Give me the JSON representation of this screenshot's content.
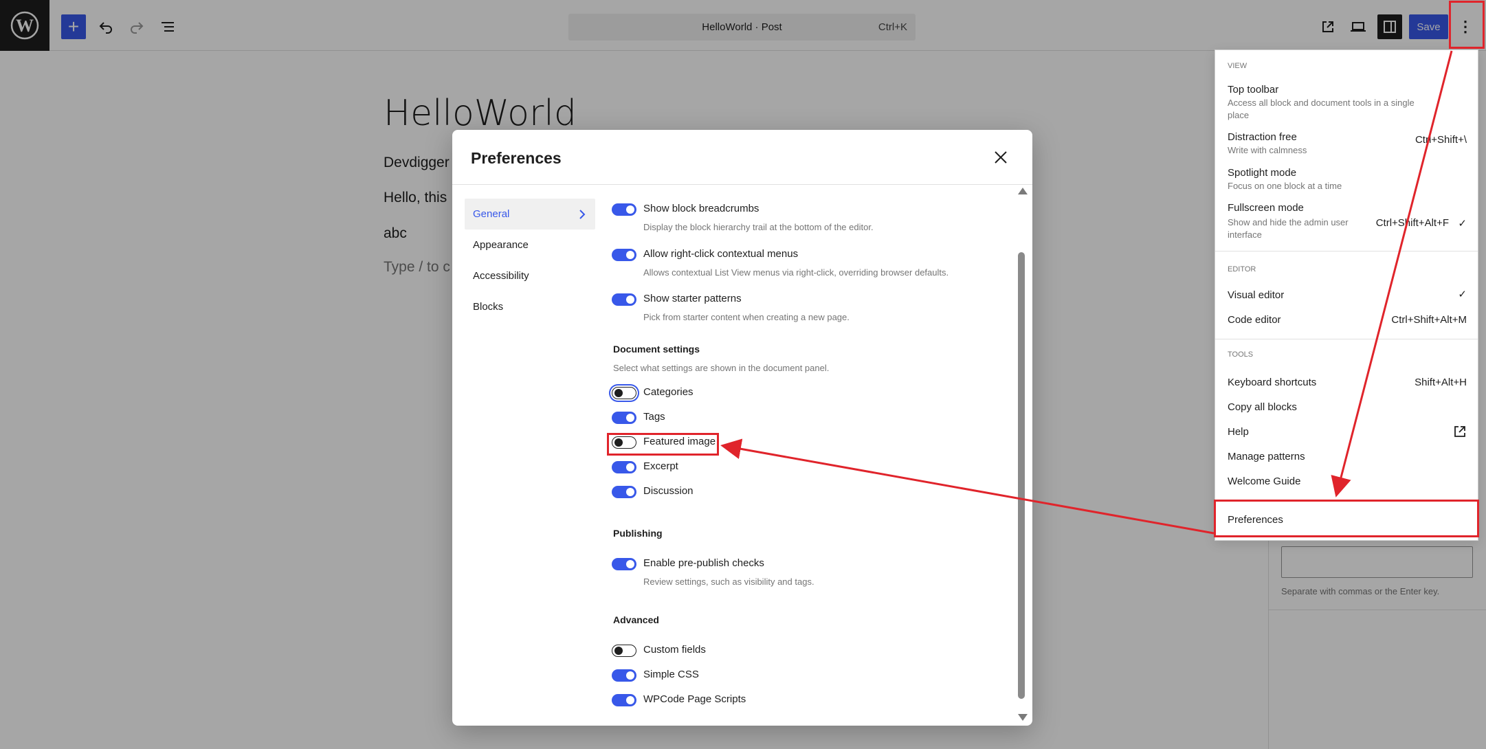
{
  "topbar": {
    "doc_title": "HelloWorld · Post",
    "doc_shortcut": "Ctrl+K",
    "save_label": "Save",
    "add_symbol": "+",
    "options_symbol": "⋮"
  },
  "editor": {
    "post_title": "HelloWorld",
    "paragraphs": [
      "Devdigger",
      "Hello, this",
      "abc"
    ],
    "placeholder": "Type / to c"
  },
  "sidebar": {
    "tags_help": "Separate with commas or the Enter key."
  },
  "preferences": {
    "title": "Preferences",
    "nav": [
      {
        "label": "General",
        "active": true
      },
      {
        "label": "Appearance"
      },
      {
        "label": "Accessibility"
      },
      {
        "label": "Blocks"
      }
    ],
    "options": [
      {
        "label": "Show block breadcrumbs",
        "help": "Display the block hierarchy trail at the bottom of the editor.",
        "enabled": true
      },
      {
        "label": "Allow right-click contextual menus",
        "help": "Allows contextual List View menus via right-click, overriding browser defaults.",
        "enabled": true
      },
      {
        "label": "Show starter patterns",
        "help": "Pick from starter content when creating a new page.",
        "enabled": true
      }
    ],
    "document_settings": {
      "title": "Document settings",
      "description": "Select what settings are shown in the document panel.",
      "items": [
        {
          "label": "Categories",
          "enabled": false
        },
        {
          "label": "Tags",
          "enabled": true
        },
        {
          "label": "Featured image",
          "enabled": false
        },
        {
          "label": "Excerpt",
          "enabled": true
        },
        {
          "label": "Discussion",
          "enabled": true
        }
      ]
    },
    "publishing": {
      "title": "Publishing",
      "items": [
        {
          "label": "Enable pre-publish checks",
          "help": "Review settings, such as visibility and tags.",
          "enabled": true
        }
      ]
    },
    "advanced": {
      "title": "Advanced",
      "items": [
        {
          "label": "Custom fields",
          "enabled": false
        },
        {
          "label": "Simple CSS",
          "enabled": true
        },
        {
          "label": "WPCode Page Scripts",
          "enabled": true
        }
      ]
    }
  },
  "options_menu": {
    "view": {
      "label": "View",
      "items": [
        {
          "label": "Top toolbar",
          "desc": "Access all block and document tools in a single place"
        },
        {
          "label": "Distraction free",
          "desc": "Write with calmness",
          "shortcut": "Ctrl+Shift+\\"
        },
        {
          "label": "Spotlight mode",
          "desc": "Focus on one block at a time"
        },
        {
          "label": "Fullscreen mode",
          "desc": "Show and hide the admin user interface",
          "shortcut": "Ctrl+Shift+Alt+F",
          "checked": "✓"
        }
      ]
    },
    "editor": {
      "label": "Editor",
      "items": [
        {
          "label": "Visual editor",
          "checked": "✓"
        },
        {
          "label": "Code editor",
          "shortcut": "Ctrl+Shift+Alt+M"
        }
      ]
    },
    "tools": {
      "label": "Tools",
      "items": [
        {
          "label": "Keyboard shortcuts",
          "shortcut": "Shift+Alt+H"
        },
        {
          "label": "Copy all blocks"
        },
        {
          "label": "Help"
        },
        {
          "label": "Manage patterns"
        },
        {
          "label": "Welcome Guide"
        }
      ]
    },
    "preferences_label": "Preferences"
  },
  "colors": {
    "accent": "#3858e9",
    "annotation": "#e0242b",
    "dark": "#1e1e1e"
  }
}
